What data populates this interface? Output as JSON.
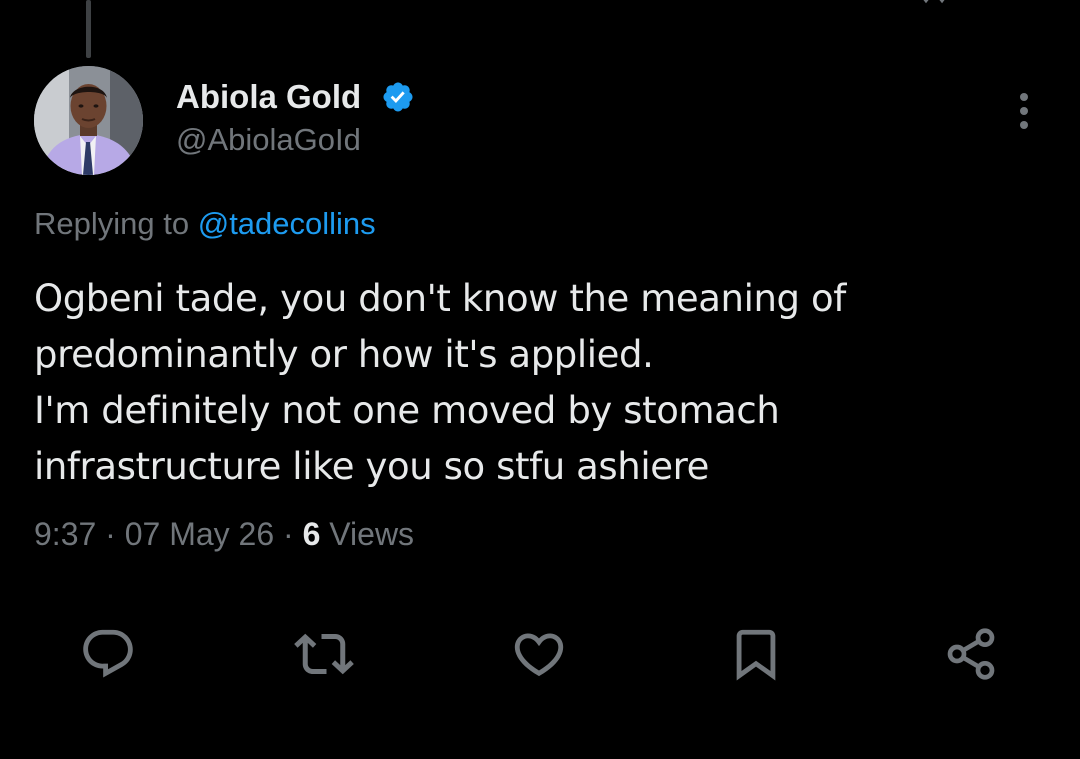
{
  "author": {
    "name": "Abiola Gold",
    "handle": "@AbiolaGoId",
    "verified": true
  },
  "reply": {
    "prefix": "Replying to",
    "mention": "@tadecollins"
  },
  "tweet": {
    "lines": [
      "Ogbeni tade, you don't know the meaning of",
      "predominantly or how it's applied.",
      "I'm definitely not one moved by stomach",
      "infrastructure like you so stfu ashiere"
    ]
  },
  "meta": {
    "time": "9:37",
    "separator": "·",
    "date": "07 May 26",
    "views_count": "6",
    "views_label": "Views"
  },
  "actions": {
    "icons": [
      "reply-icon",
      "retweet-icon",
      "like-icon",
      "bookmark-icon",
      "share-icon"
    ]
  },
  "colors": {
    "background": "#000000",
    "text_primary": "#e7e9ea",
    "text_secondary": "#71767b",
    "accent": "#1d9bf0",
    "icon": "#71767b"
  }
}
